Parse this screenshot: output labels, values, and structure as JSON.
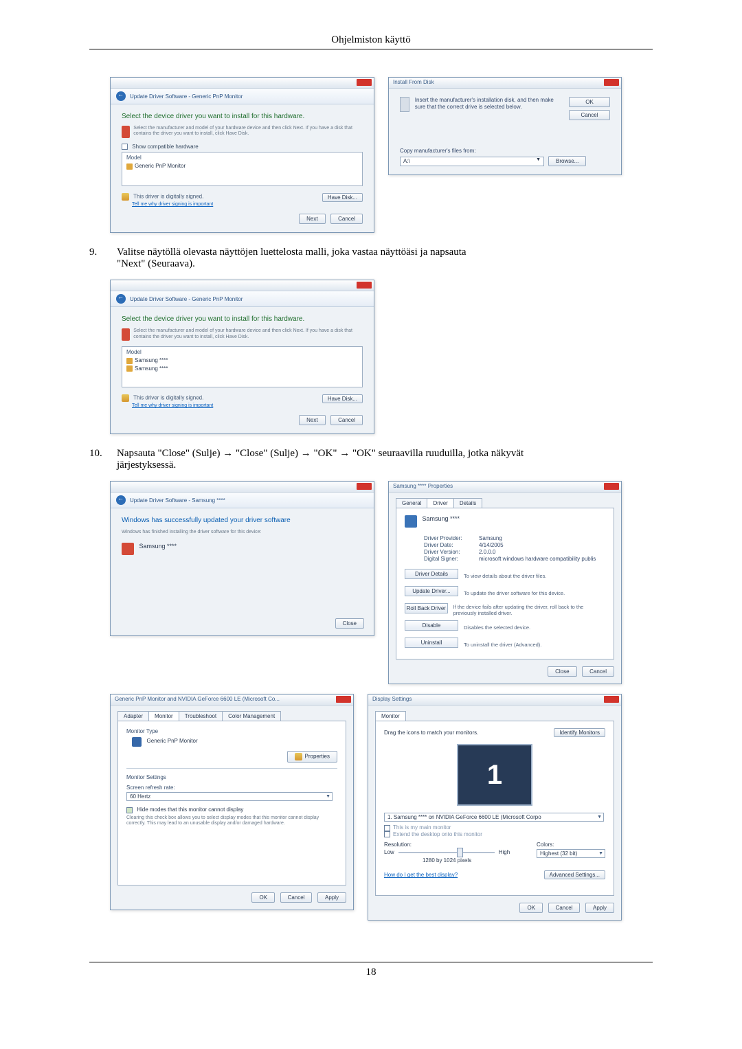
{
  "header": {
    "title": "Ohjelmiston käyttö"
  },
  "page_number": "18",
  "wiz1": {
    "breadcrumb": "Update Driver Software - Generic PnP Monitor",
    "heading": "Select the device driver you want to install for this hardware.",
    "tip": "Select the manufacturer and model of your hardware device and then click Next. If you have a disk that contains the driver you want to install, click Have Disk.",
    "show_compat": "Show compatible hardware",
    "model_hdr": "Model",
    "row": "Generic PnP Monitor",
    "signed": "This driver is digitally signed.",
    "signed_link": "Tell me why driver signing is important",
    "have_disk": "Have Disk...",
    "next": "Next",
    "cancel": "Cancel"
  },
  "ifd": {
    "title": "Install From Disk",
    "msg": "Insert the manufacturer's installation disk, and then make sure that the correct drive is selected below.",
    "ok": "OK",
    "cancel": "Cancel",
    "copy": "Copy manufacturer's files from:",
    "path": "A:\\",
    "browse": "Browse..."
  },
  "step9": {
    "num": "9.",
    "text_line1": "Valitse näytöllä olevasta näyttöjen luettelosta malli, joka vastaa näyttöäsi ja napsauta",
    "text_line2": "\"Next\" (Seuraava)."
  },
  "wiz2": {
    "breadcrumb": "Update Driver Software - Generic PnP Monitor",
    "heading": "Select the device driver you want to install for this hardware.",
    "tip": "Select the manufacturer and model of your hardware device and then click Next. If you have a disk that contains the driver you want to install, click Have Disk.",
    "model_hdr": "Model",
    "rowA": "Samsung ****",
    "rowB": "Samsung ****",
    "signed": "This driver is digitally signed.",
    "signed_link": "Tell me why driver signing is important",
    "have_disk": "Have Disk...",
    "next": "Next",
    "cancel": "Cancel"
  },
  "step10": {
    "num": "10.",
    "text_line1": "Napsauta \"Close\" (Sulje) → \"Close\" (Sulje) → \"OK\" → \"OK\" seuraavilla ruuduilla, jotka näkyvät",
    "text_line2": "järjestyksessä."
  },
  "wiz3": {
    "breadcrumb": "Update Driver Software - Samsung ****",
    "heading": "Windows has successfully updated your driver software",
    "sub": "Windows has finished installing the driver software for this device:",
    "item": "Samsung ****",
    "close": "Close"
  },
  "props": {
    "title": "Samsung **** Properties",
    "tab_general": "General",
    "tab_driver": "Driver",
    "tab_details": "Details",
    "dev": "Samsung ****",
    "provider_label": "Driver Provider:",
    "provider": "Samsung",
    "date_label": "Driver Date:",
    "date": "4/14/2005",
    "version_label": "Driver Version:",
    "version": "2.0.0.0",
    "signer_label": "Digital Signer:",
    "signer": "microsoft windows hardware compatibility publis",
    "btn_details": "Driver Details",
    "desc_details": "To view details about the driver files.",
    "btn_update": "Update Driver...",
    "desc_update": "To update the driver software for this device.",
    "btn_rollback": "Roll Back Driver",
    "desc_rollback": "If the device fails after updating the driver, roll back to the previously installed driver.",
    "btn_disable": "Disable",
    "desc_disable": "Disables the selected device.",
    "btn_uninstall": "Uninstall",
    "desc_uninstall": "To uninstall the driver (Advanced).",
    "close": "Close",
    "cancel": "Cancel"
  },
  "monprops": {
    "title": "Generic PnP Monitor and NVIDIA GeForce 6600 LE (Microsoft Co...",
    "tab_adapter": "Adapter",
    "tab_monitor": "Monitor",
    "tab_trouble": "Troubleshoot",
    "tab_color": "Color Management",
    "type_label": "Monitor Type",
    "type_val": "Generic PnP Monitor",
    "properties": "Properties",
    "settings_label": "Monitor Settings",
    "refresh_label": "Screen refresh rate:",
    "refresh_val": "60 Hertz",
    "hide_label": "Hide modes that this monitor cannot display",
    "hide_desc": "Clearing this check box allows you to select display modes that this monitor cannot display correctly. This may lead to an unusable display and/or damaged hardware.",
    "ok": "OK",
    "cancel": "Cancel",
    "apply": "Apply"
  },
  "dispset": {
    "title": "Display Settings",
    "tab_monitor": "Monitor",
    "drag": "Drag the icons to match your monitors.",
    "identify": "Identify Monitors",
    "num": "1",
    "sel": "1. Samsung **** on NVIDIA GeForce 6600 LE (Microsoft Corpo",
    "main": "This is my main monitor",
    "extend": "Extend the desktop onto this monitor",
    "res_label": "Resolution:",
    "low": "Low",
    "high": "High",
    "res_val": "1280 by 1024 pixels",
    "colors_label": "Colors:",
    "colors_val": "Highest (32 bit)",
    "best": "How do I get the best display?",
    "advanced": "Advanced Settings...",
    "ok": "OK",
    "cancel": "Cancel",
    "apply": "Apply"
  }
}
